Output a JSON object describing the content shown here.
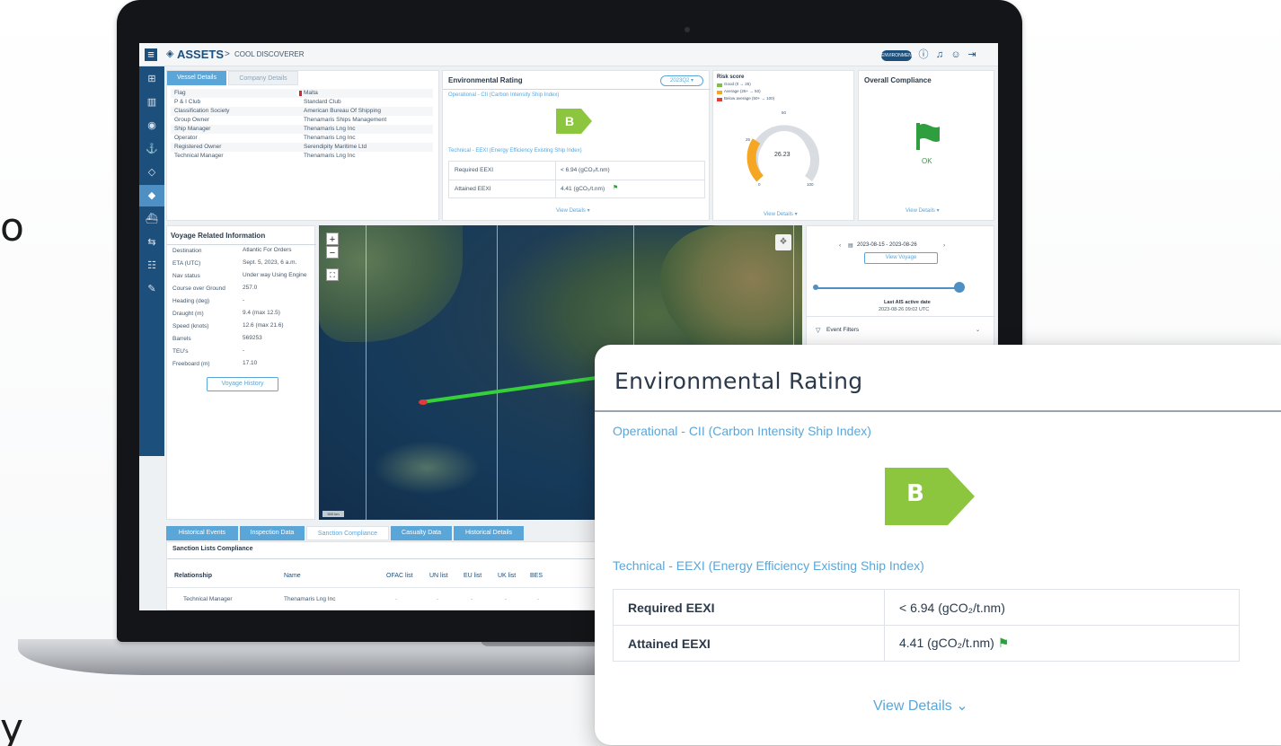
{
  "edge_text": {
    "left_top": "o",
    "left_bottom": "y"
  },
  "app": {
    "breadcrumb_root": "ASSETS",
    "breadcrumb_sep": ">",
    "breadcrumb_current": "COOL DISCOVERER",
    "top_pill": "ENVIRONMENTAL",
    "icons": [
      "help-icon",
      "bell-icon",
      "user-icon",
      "logout-icon"
    ]
  },
  "sidebar": {
    "items": [
      {
        "icon": "grid-icon",
        "glyph": "⊞"
      },
      {
        "icon": "building-icon",
        "glyph": "▥"
      },
      {
        "icon": "location-icon",
        "glyph": "◉"
      },
      {
        "icon": "anchor-icon",
        "glyph": "⚓"
      },
      {
        "icon": "tag-icon",
        "glyph": "◇"
      },
      {
        "icon": "diamond-icon",
        "glyph": "◆"
      },
      {
        "icon": "ship-icon",
        "glyph": "⛴"
      },
      {
        "icon": "exchange-icon",
        "glyph": "⇆"
      },
      {
        "icon": "people-icon",
        "glyph": "☷"
      },
      {
        "icon": "tool-icon",
        "glyph": "✎"
      }
    ]
  },
  "vessel_details": {
    "tabs": [
      "Vessel Details",
      "Company Details"
    ],
    "rows": [
      {
        "label": "Flag",
        "value": "Malta"
      },
      {
        "label": "P & I Club",
        "value": "Standard Club"
      },
      {
        "label": "Classification Society",
        "value": "American Bureau Of Shipping"
      },
      {
        "label": "Group Owner",
        "value": "Thenamaris Ships Management"
      },
      {
        "label": "Ship Manager",
        "value": "Thenamaris Lng Inc"
      },
      {
        "label": "Operator",
        "value": "Thenamaris Lng Inc"
      },
      {
        "label": "Registered Owner",
        "value": "Serendipity Maritime Ltd"
      },
      {
        "label": "Technical Manager",
        "value": "Thenamaris Lng Inc"
      }
    ]
  },
  "env_small": {
    "title": "Environmental Rating",
    "period": "2023Q2 ▾",
    "operational": "Operational - CII (Carbon Intensity Ship Index)",
    "rating": "B",
    "technical": "Technical - EEXI (Energy Efficiency Existing Ship Index)",
    "rows": [
      {
        "label": "Required EEXI",
        "value": "< 6.94 (gCO₂/t.nm)"
      },
      {
        "label": "Attained EEXI",
        "value": "4.41 (gCO₂/t.nm)"
      }
    ],
    "view_details": "View Details ▾"
  },
  "risk": {
    "title": "Risk score",
    "legend": [
      {
        "label": "Good (0 → 25)",
        "color": "#7cc242"
      },
      {
        "label": "Average (25+ → 50)",
        "color": "#f5a623"
      },
      {
        "label": "Below average (50+ → 100)",
        "color": "#e0403c"
      }
    ],
    "score": "26.23",
    "tick_top": "50",
    "tick_left": "25",
    "tick_bl": "0",
    "tick_br": "100",
    "view_details": "View Details ▾"
  },
  "compliance": {
    "title": "Overall Compliance",
    "status": "OK",
    "view_details": "View Details ▾"
  },
  "voyage": {
    "title": "Voyage Related Information",
    "rows": [
      {
        "label": "Destination",
        "value": "Atlantic For Orders"
      },
      {
        "label": "ETA (UTC)",
        "value": "Sept. 5, 2023, 6 a.m."
      },
      {
        "label": "Nav status",
        "value": "Under way Using Engine"
      },
      {
        "label": "Course over Ground",
        "value": "257.0"
      },
      {
        "label": "Heading (deg)",
        "value": "-"
      },
      {
        "label": "Draught (m)",
        "value": "9.4 (max 12.5)"
      },
      {
        "label": "Speed (knots)",
        "value": "12.6 (max 21.6)"
      },
      {
        "label": "Barrels",
        "value": "569253"
      },
      {
        "label": "TEU's",
        "value": "-"
      },
      {
        "label": "Freeboard (m)",
        "value": "17.10"
      }
    ],
    "history_button": "Voyage History"
  },
  "map": {
    "zoom_in": "+",
    "zoom_out": "−",
    "fullscreen": "⛶",
    "scale": "500 km"
  },
  "timeline": {
    "date_range": "2023-08-15 - 2023-08-26",
    "view_voyage": "View Voyage",
    "last_ais_label": "Last AIS active date",
    "last_ais_value": "2023-08-26 09:02 UTC",
    "event_filters": "Event Filters"
  },
  "bottom": {
    "tabs": [
      "Historical Events",
      "Inspection Data",
      "Sanction Compliance",
      "Casualty Data",
      "Historical Details"
    ],
    "active_tab": 2,
    "section_title": "Sanction Lists Compliance",
    "columns": [
      "Relationship",
      "Name",
      "OFAC list",
      "UN list",
      "EU list",
      "UK list",
      "BES"
    ],
    "row": [
      "Technical Manager",
      "Thenamaris Lng Inc",
      "-",
      "-",
      "-",
      "-",
      "-"
    ]
  },
  "card": {
    "title": "Environmental Rating",
    "operational": "Operational - CII (Carbon Intensity Ship Index)",
    "rating": "B",
    "technical": "Technical - EEXI (Energy Efficiency Existing Ship Index)",
    "required_label": "Required EEXI",
    "required_value": "< 6.94 (gCO₂/t.nm)",
    "attained_label": "Attained EEXI",
    "attained_value": "4.41 (gCO₂/t.nm)",
    "view_details": "View Details",
    "accent": "#5ba6d8",
    "rating_color": "#8cc63f"
  }
}
